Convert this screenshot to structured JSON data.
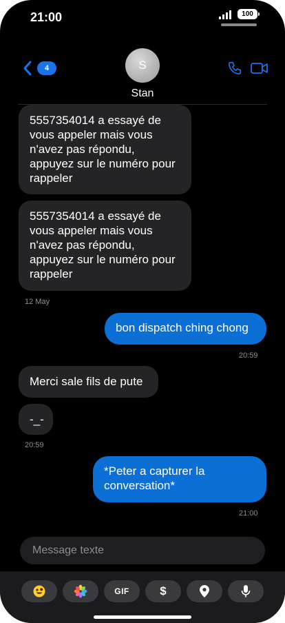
{
  "status_bar": {
    "time": "21:00",
    "battery": "100"
  },
  "header": {
    "unread_count": "4",
    "avatar_initial": "S",
    "contact_name": "Stan"
  },
  "messages": [
    {
      "direction": "incoming",
      "text": "5557354014 a essayé de vous appeler mais vous n'avez pas répondu, appuyez sur le numéro pour rappeler"
    },
    {
      "direction": "incoming",
      "text": "5557354014 a essayé de vous appeler mais vous n'avez pas répondu, appuyez sur le numéro pour rappeler"
    },
    {
      "direction": "incoming",
      "time": "12 May"
    },
    {
      "direction": "outgoing",
      "text": "bon dispatch ching chong",
      "time": "20:59"
    },
    {
      "direction": "incoming",
      "text": "Merci sale fils de pute"
    },
    {
      "direction": "incoming",
      "text": "-_-",
      "time": "20:59"
    },
    {
      "direction": "outgoing",
      "text": "*Peter a capturer la conversation*",
      "time": "21:00"
    }
  ],
  "composer": {
    "placeholder": "Message texte"
  },
  "toolbar": {
    "buttons": [
      {
        "icon": "emoji-icon"
      },
      {
        "icon": "photos-icon"
      },
      {
        "label": "GIF"
      },
      {
        "label": "$"
      },
      {
        "icon": "location-pin-icon"
      },
      {
        "icon": "microphone-icon"
      }
    ]
  },
  "colors": {
    "outgoing_bubble": "#0b6fd6",
    "incoming_bubble": "#242426",
    "accent": "#1a73e8",
    "background": "#000000"
  }
}
